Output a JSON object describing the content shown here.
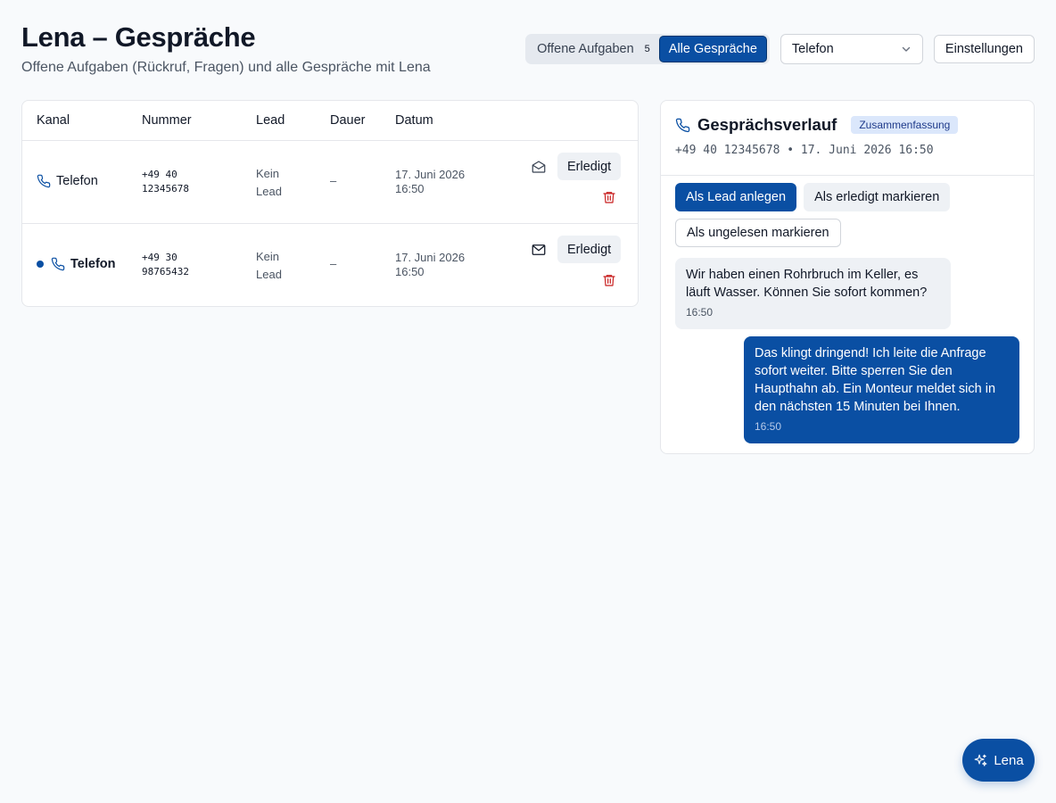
{
  "header": {
    "title": "Lena – Gespräche",
    "subtitle": "Offene Aufgaben (Rückruf, Fragen) und alle Gespräche mit Lena"
  },
  "toolbar": {
    "tab_open": "Offene Aufgaben",
    "tab_open_count": "5",
    "tab_all": "Alle Gespräche",
    "active_tab": "Alle Gespräche",
    "channel_select": "Telefon",
    "settings": "Einstellungen"
  },
  "table": {
    "columns": [
      "Kanal",
      "Nummer",
      "Lead",
      "Dauer",
      "Datum"
    ],
    "rows": [
      {
        "kanal": "Telefon",
        "nummer": "+49 40\n12345678",
        "lead": "Kein Lead",
        "dauer": "–",
        "datum": "17. Juni 2026\n16:50",
        "action": "Erledigt",
        "unread": false
      },
      {
        "kanal": "Telefon",
        "nummer": "+49 30\n98765432",
        "lead": "Kein Lead",
        "dauer": "–",
        "datum": "17. Juni 2026\n16:50",
        "action": "Erledigt",
        "unread": true
      }
    ]
  },
  "detail": {
    "title": "Gesprächsverlauf",
    "badge": "Zusammenfassung",
    "meta": "+49 40 12345678 • 17. Juni 2026 16:50",
    "actions": {
      "create_lead": "Als Lead anlegen",
      "mark_done": "Als erledigt markieren",
      "mark_unread": "Als ungelesen markieren"
    },
    "messages": [
      {
        "text": "Wir haben einen Rohrbruch im Keller, es läuft Wasser. Können Sie sofort kommen?",
        "time": "16:50"
      },
      {
        "text": "Das klingt dringend! Ich leite die Anfrage sofort weiter. Bitte sperren Sie den Haupthahn ab. Ein Monteur meldet sich in den nächsten 15 Minuten bei Ihnen.",
        "time": "16:50"
      }
    ]
  },
  "fab": {
    "label": "Lena"
  },
  "colors": {
    "primary": "#0a4fa3",
    "danger": "#c81e1e",
    "background": "#f8fafc"
  }
}
